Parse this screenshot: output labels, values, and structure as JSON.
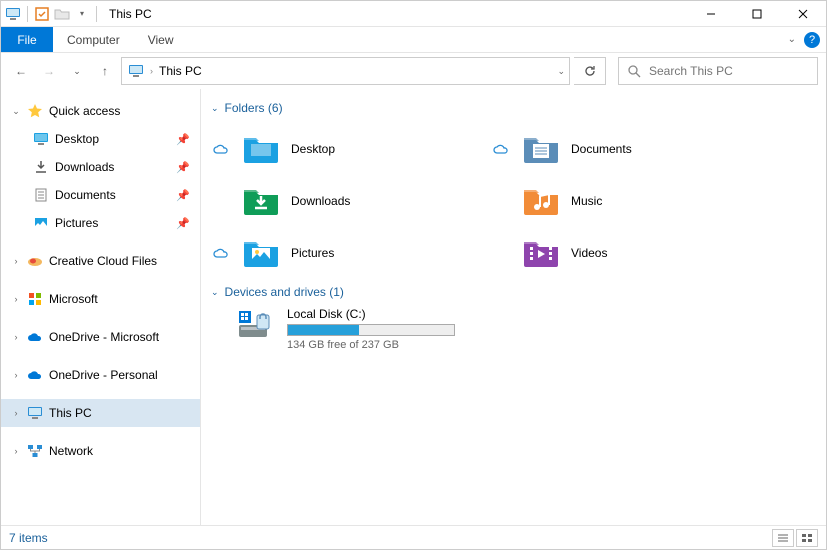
{
  "titlebar": {
    "title": "This PC"
  },
  "ribbon": {
    "file": "File",
    "tabs": [
      "Computer",
      "View"
    ]
  },
  "nav": {
    "breadcrumb": "This PC",
    "search_placeholder": "Search This PC"
  },
  "sidebar": {
    "quick_access": {
      "label": "Quick access",
      "items": [
        {
          "label": "Desktop",
          "icon": "desktop",
          "pinned": true
        },
        {
          "label": "Downloads",
          "icon": "downloads",
          "pinned": true
        },
        {
          "label": "Documents",
          "icon": "documents",
          "pinned": true
        },
        {
          "label": "Pictures",
          "icon": "pictures",
          "pinned": true
        }
      ]
    },
    "groups": [
      {
        "label": "Creative Cloud Files",
        "icon": "creative-cloud"
      },
      {
        "label": "Microsoft",
        "icon": "microsoft"
      },
      {
        "label": "OneDrive - Microsoft",
        "icon": "onedrive"
      },
      {
        "label": "OneDrive - Personal",
        "icon": "onedrive"
      },
      {
        "label": "This PC",
        "icon": "this-pc",
        "selected": true
      },
      {
        "label": "Network",
        "icon": "network"
      }
    ]
  },
  "main": {
    "folders_header": "Folders (6)",
    "folders": [
      {
        "label": "Desktop",
        "cloud": true,
        "color": "#1ba1e2"
      },
      {
        "label": "Documents",
        "cloud": true,
        "color": "#5b8db8"
      },
      {
        "label": "Downloads",
        "cloud": false,
        "color": "#0f9d58"
      },
      {
        "label": "Music",
        "cloud": false,
        "color": "#f28c38"
      },
      {
        "label": "Pictures",
        "cloud": true,
        "color": "#1ba1e2"
      },
      {
        "label": "Videos",
        "cloud": false,
        "color": "#8e44ad"
      }
    ],
    "drives_header": "Devices and drives (1)",
    "drive": {
      "label": "Local Disk (C:)",
      "free_text": "134 GB free of 237 GB",
      "used_percent": 43
    }
  },
  "status": {
    "text": "7 items"
  }
}
